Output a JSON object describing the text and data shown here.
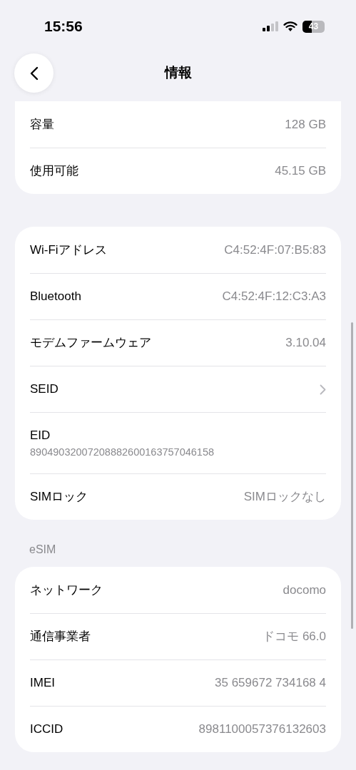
{
  "status_bar": {
    "time": "15:56",
    "battery": "43"
  },
  "nav": {
    "title": "情報"
  },
  "sections": [
    {
      "rows": [
        {
          "kind": "value",
          "label": "容量",
          "value": "128 GB"
        },
        {
          "kind": "value",
          "label": "使用可能",
          "value": "45.15 GB"
        }
      ]
    },
    {
      "rows": [
        {
          "kind": "value",
          "label": "Wi-Fiアドレス",
          "value": "C4:52:4F:07:B5:83"
        },
        {
          "kind": "value",
          "label": "Bluetooth",
          "value": "C4:52:4F:12:C3:A3"
        },
        {
          "kind": "value",
          "label": "モデムファームウェア",
          "value": "3.10.04"
        },
        {
          "kind": "link",
          "label": "SEID"
        },
        {
          "kind": "stacked",
          "label": "EID",
          "value": "89049032007208882600163757046158"
        },
        {
          "kind": "value",
          "label": "SIMロック",
          "value": "SIMロックなし"
        }
      ]
    },
    {
      "header": "eSIM",
      "rows": [
        {
          "kind": "value",
          "label": "ネットワーク",
          "value": "docomo"
        },
        {
          "kind": "value",
          "label": "通信事業者",
          "value": "ドコモ 66.0"
        },
        {
          "kind": "value",
          "label": "IMEI",
          "value": "35 659672 734168 4"
        },
        {
          "kind": "value",
          "label": "ICCID",
          "value": "8981100057376132603"
        }
      ]
    }
  ]
}
